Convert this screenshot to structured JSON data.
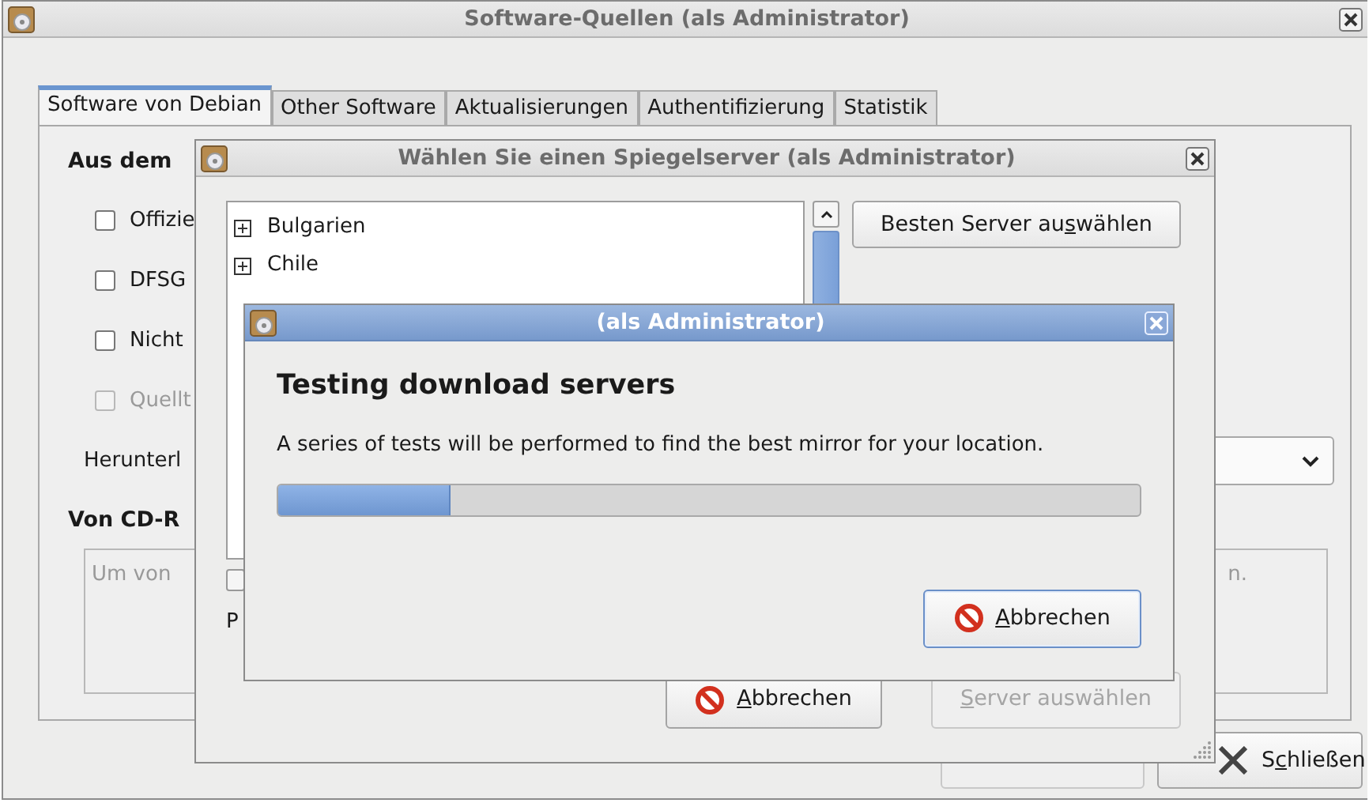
{
  "main_window": {
    "title": "Software-Quellen (als Administrator)",
    "tabs": [
      {
        "label": "Software von Debian",
        "selected": true
      },
      {
        "label": "Other Software",
        "selected": false
      },
      {
        "label": "Aktualisierungen",
        "selected": false
      },
      {
        "label": "Authentifizierung",
        "selected": false
      },
      {
        "label": "Statistik",
        "selected": false
      }
    ],
    "section_heading": "Aus dem",
    "checkboxes": [
      {
        "label": "Offizie",
        "checked": false,
        "disabled": false
      },
      {
        "label": "DFSG",
        "checked": false,
        "disabled": false
      },
      {
        "label": "Nicht",
        "checked": false,
        "disabled": false
      },
      {
        "label": "Quellt",
        "checked": false,
        "disabled": true
      }
    ],
    "download_label": "Herunterl",
    "cdrom_heading": "Von CD-R",
    "cdrom_note_start": "Um von",
    "cdrom_note_end": "n.",
    "close_button": {
      "before": "S",
      "key": "c",
      "after": "hließen"
    }
  },
  "mirror_dialog": {
    "title": "Wählen Sie einen Spiegelserver (als Administrator)",
    "countries": [
      {
        "label": "Bulgarien",
        "expanded": false
      },
      {
        "label": "Chile",
        "expanded": false
      }
    ],
    "best_server_button": {
      "before": "Besten Server au",
      "key": "s",
      "after": "wählen"
    },
    "partial_label": "P",
    "cancel_button": {
      "key": "A",
      "after": "bbrechen"
    },
    "select_button": {
      "key": "S",
      "after": "erver auswählen",
      "disabled": true
    }
  },
  "progress_dialog": {
    "title": "(als Administrator)",
    "heading": "Testing download servers",
    "message": "A series of tests will be performed to find the best mirror for your location.",
    "progress": {
      "level": 0.2
    },
    "cancel_button": {
      "key": "A",
      "after": "bbrechen"
    }
  }
}
